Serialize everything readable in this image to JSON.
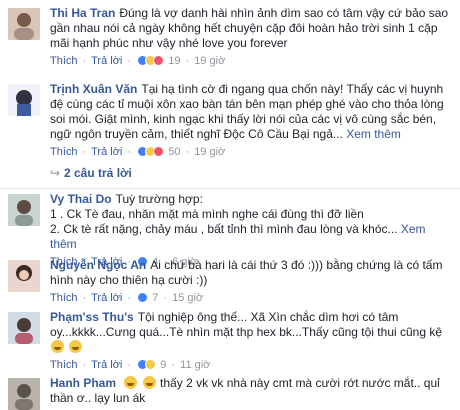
{
  "comments": [
    {
      "author": "Thi Ha Tran",
      "text": "Đúng là vợ danh hài nhìn ảnh dìm sao có tâm vậy cứ bảo sao gần nhau nói cả ngày không hết chuyện cặp đôi hoàn hảo trời sinh 1 cặp mãi hạnh phúc như vậy nhé love you forever",
      "like": "Thích",
      "reply": "Trả lời",
      "count": "19",
      "time": "19 giờ"
    },
    {
      "author": "Trịnh Xuân Văn",
      "text": "Tại hạ tình cờ đi ngang qua chốn này! Thấy các vị huynh đệ cùng các tỉ muội xôn xao bàn tán bên mạn phép ghé vào cho thỏa lòng soi mói. Giật mình, kinh ngạc khi thấy lời nói của các vị vô cùng sắc bén, ngữ ngôn truyền cảm, thiết nghĩ Độc Cô Cầu Bại ngả...",
      "see_more": "Xem thêm",
      "like": "Thích",
      "reply": "Trả lời",
      "count": "50",
      "time": "19 giờ",
      "replies_label": "2 câu trả lời"
    },
    {
      "author": "Vy Thai Do",
      "text_lines": [
        "Tuỳ trường hợp:",
        "1 . Ck Tè đau, nhăn mặt mà mình nghe cái đùng thì đỡ liền",
        "2. Ck tè rất nặng, chảy máu , bất tỉnh thì mình đau lòng và khóc..."
      ],
      "see_more": "Xem thêm",
      "like": "Thích",
      "reply": "Trả lời",
      "count": "4",
      "time": "6 giờ"
    },
    {
      "author": "Nguyễn Ngọc An",
      "text": "Ai chứ bà hari là cái thứ 3 đó :))) bằng chứng là có tấm hình này cho thiên hạ cười :))",
      "like": "Thích",
      "reply": "Trả lời",
      "count": "7",
      "time": "15 giờ"
    },
    {
      "author": "Phạm'ss Thu's",
      "text": "Tội nghiệp ông thế... Xã Xìn chắc dìm hơi có tâm oy...kkkk...Cưng quá...Tè nhìn mặt thp hex bk...Thấy cũng tội thui cũng kệ",
      "like": "Thích",
      "reply": "Trả lời",
      "count": "9",
      "time": "11 giờ"
    },
    {
      "author": "Hanh Pham",
      "text": "thấy 2 vk vk nhà này cmt mà cười rớt nước mắt.. quỉ thần ơ.. lạy lun ák"
    }
  ]
}
